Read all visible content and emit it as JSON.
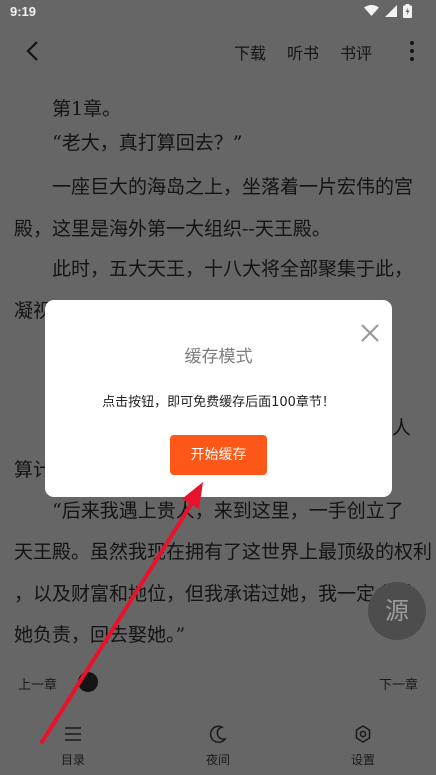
{
  "status_bar": {
    "time": "9:19"
  },
  "top_bar": {
    "download": "下载",
    "listen": "听书",
    "review": "书评"
  },
  "content": {
    "lines": [
      "　　第1章。",
      "　　“老大，真打算回去？”",
      "　　一座巨大的海岛之上，坐落着一片宏伟的宫",
      "殿，这里是海外第一大组织--天王殿。",
      "　　此时，五大天王，十八大将全部聚集于此，",
      "凝视",
      "",
      "",
      "",
      "",
      "算计",
      "　　“后来我遇上贵人，来到这里，一手创立了",
      "天王殿。虽然我现在拥有了这世界上最顶级的权利",
      "，以及财富和地位，但我承诺过她，我一定会对",
      "她负责，回去娶她。”"
    ],
    "partial_right": "人"
  },
  "fab": {
    "label": "源"
  },
  "progress": {
    "prev": "上一章",
    "next": "下一章",
    "value": 0.17
  },
  "bottom_bar": {
    "catalog": "目录",
    "night": "夜间",
    "settings": "设置"
  },
  "dialog": {
    "title": "缓存模式",
    "message": "点击按钮，即可免费缓存后面100章节！",
    "button": "开始缓存"
  },
  "colors": {
    "accent": "#ff5718",
    "overlay_bg": "#666666",
    "arrow": "#e8122a"
  }
}
